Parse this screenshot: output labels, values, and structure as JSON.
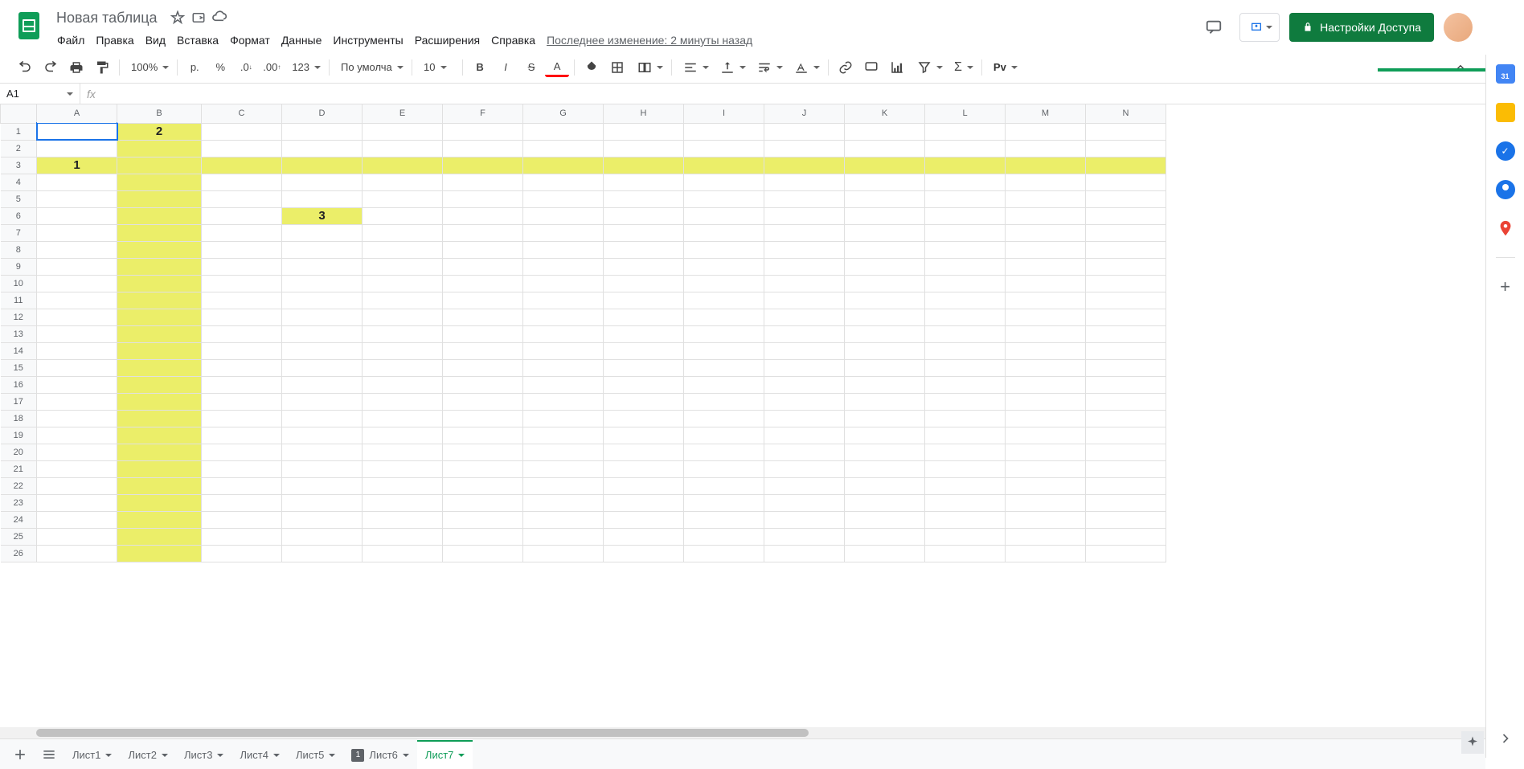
{
  "doc": {
    "title": "Новая таблица"
  },
  "menu": {
    "file": "Файл",
    "edit": "Правка",
    "view": "Вид",
    "insert": "Вставка",
    "format": "Формат",
    "data": "Данные",
    "tools": "Инструменты",
    "extensions": "Расширения",
    "help": "Справка",
    "last_edit": "Последнее изменение: 2 минуты назад"
  },
  "share": {
    "label": "Настройки Доступа"
  },
  "toolbar": {
    "zoom": "100%",
    "currency": "р.",
    "font": "По умолча...",
    "size": "10",
    "pv": "Pv"
  },
  "formula": {
    "cell_ref": "A1",
    "fx": "fx",
    "value": ""
  },
  "columns": [
    "A",
    "B",
    "C",
    "D",
    "E",
    "F",
    "G",
    "H",
    "I",
    "J",
    "K",
    "L",
    "M",
    "N"
  ],
  "rows": 26,
  "cells": {
    "B1": "2",
    "A3": "1",
    "D6": "3"
  },
  "highlight": {
    "column": "B",
    "row": 3,
    "extras": [
      {
        "r": 6,
        "c": "D"
      }
    ]
  },
  "selected": {
    "r": 1,
    "c": "A"
  },
  "sheets": [
    {
      "name": "Лист1",
      "active": false,
      "badge": null
    },
    {
      "name": "Лист2",
      "active": false,
      "badge": null
    },
    {
      "name": "Лист3",
      "active": false,
      "badge": null
    },
    {
      "name": "Лист4",
      "active": false,
      "badge": null
    },
    {
      "name": "Лист5",
      "active": false,
      "badge": null
    },
    {
      "name": "Лист6",
      "active": false,
      "badge": "1"
    },
    {
      "name": "Лист7",
      "active": true,
      "badge": null
    }
  ],
  "sidepanel": {
    "cal_day": "31"
  }
}
